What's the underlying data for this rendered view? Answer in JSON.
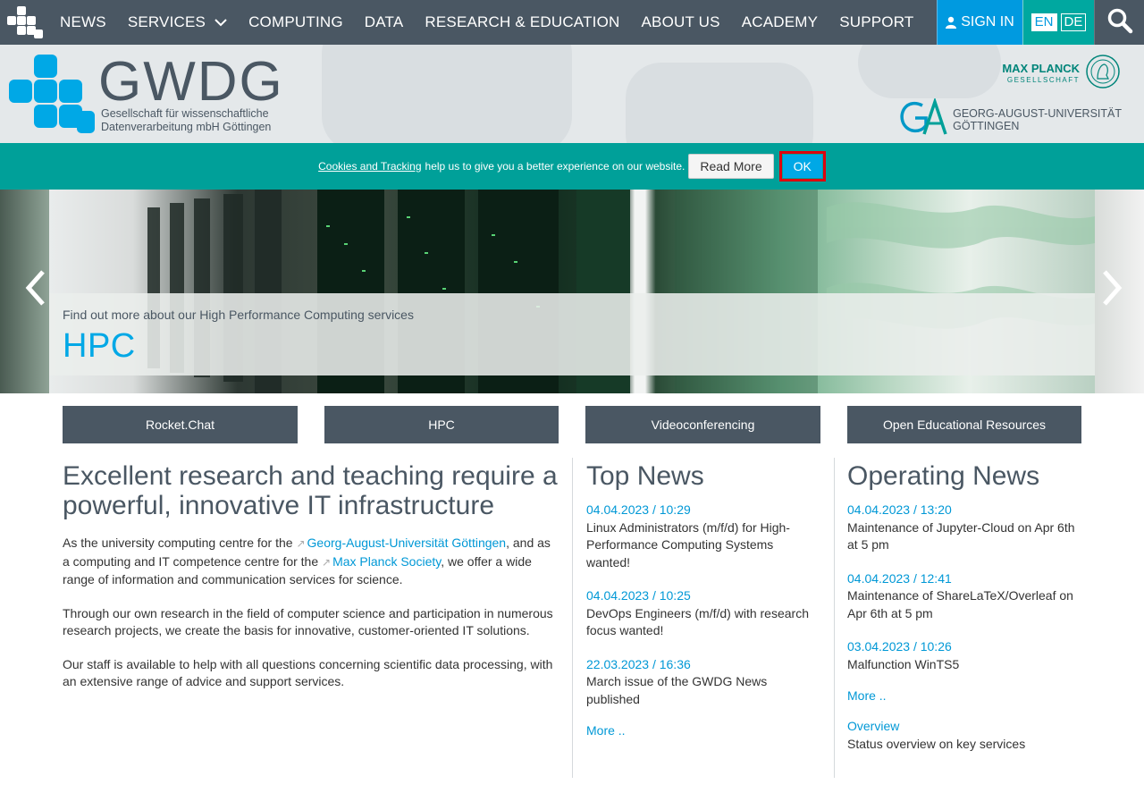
{
  "nav": {
    "items": [
      {
        "label": "NEWS"
      },
      {
        "label": "SERVICES"
      },
      {
        "label": "COMPUTING"
      },
      {
        "label": "DATA"
      },
      {
        "label": "RESEARCH & EDUCATION"
      },
      {
        "label": "ABOUT US"
      },
      {
        "label": "ACADEMY"
      },
      {
        "label": "SUPPORT"
      }
    ],
    "signin": "SIGN IN",
    "lang_en": "EN",
    "lang_de": "DE"
  },
  "header": {
    "logo_text": "GWDG",
    "logo_sub_line1": "Gesellschaft für wissenschaftliche",
    "logo_sub_line2": "Datenverarbeitung mbH Göttingen",
    "mpg_name": "MAX PLANCK",
    "mpg_sub": "GESELLSCHAFT",
    "goe_line1": "GEORG-AUGUST-UNIVERSITÄT",
    "goe_line2": "GÖTTINGEN"
  },
  "cookie": {
    "link": "Cookies and Tracking",
    "text": "help us to give you a better experience on our website.",
    "read_more": "Read More",
    "ok": "OK"
  },
  "hero": {
    "subtitle": "Find out more about our High Performance Computing services",
    "title": "HPC"
  },
  "quick_links": [
    "Rocket.Chat",
    "HPC",
    "Videoconferencing",
    "Open Educational Resources"
  ],
  "intro": {
    "heading": "Excellent research and teaching require a powerful, innovative IT infrastructure",
    "p1_a": "As the university computing centre for the ",
    "p1_link1": "Georg-August-Universität Göttingen",
    "p1_b": ", and as a computing and IT competence centre for the ",
    "p1_link2": "Max Planck Society",
    "p1_c": ", we offer a wide range of information and communication services for science.",
    "p2": "Through our own research in the field of computer science and participation in numerous research projects, we create the basis for innovative, customer-oriented IT solutions.",
    "p3": "Our staff is available to help with all questions concerning scientific data processing, with an extensive range of advice and support services."
  },
  "top_news": {
    "heading": "Top News",
    "items": [
      {
        "date": "04.04.2023 / 10:29",
        "text": "Linux Administrators (m/f/d) for High-Performance Computing Systems wanted!"
      },
      {
        "date": "04.04.2023 / 10:25",
        "text": "DevOps Engineers (m/f/d) with research focus wanted!"
      },
      {
        "date": "22.03.2023 / 16:36",
        "text": "March issue of the GWDG News published"
      }
    ],
    "more": "More .."
  },
  "operating_news": {
    "heading": "Operating News",
    "items": [
      {
        "date": "04.04.2023 / 13:20",
        "text": "Maintenance of Jupyter-Cloud on Apr 6th at 5 pm"
      },
      {
        "date": "04.04.2023 / 12:41",
        "text": "Maintenance of ShareLaTeX/Overleaf on Apr 6th at 5 pm"
      },
      {
        "date": "03.04.2023 / 10:26",
        "text": "Malfunction WinTS5"
      }
    ],
    "more": "More ..",
    "overview_link": "Overview",
    "overview_text": "Status overview on key services"
  },
  "colors": {
    "nav": "#4a5763",
    "accent_blue": "#009ae0",
    "teal": "#00a099",
    "ok_outline": "#e0000d"
  }
}
